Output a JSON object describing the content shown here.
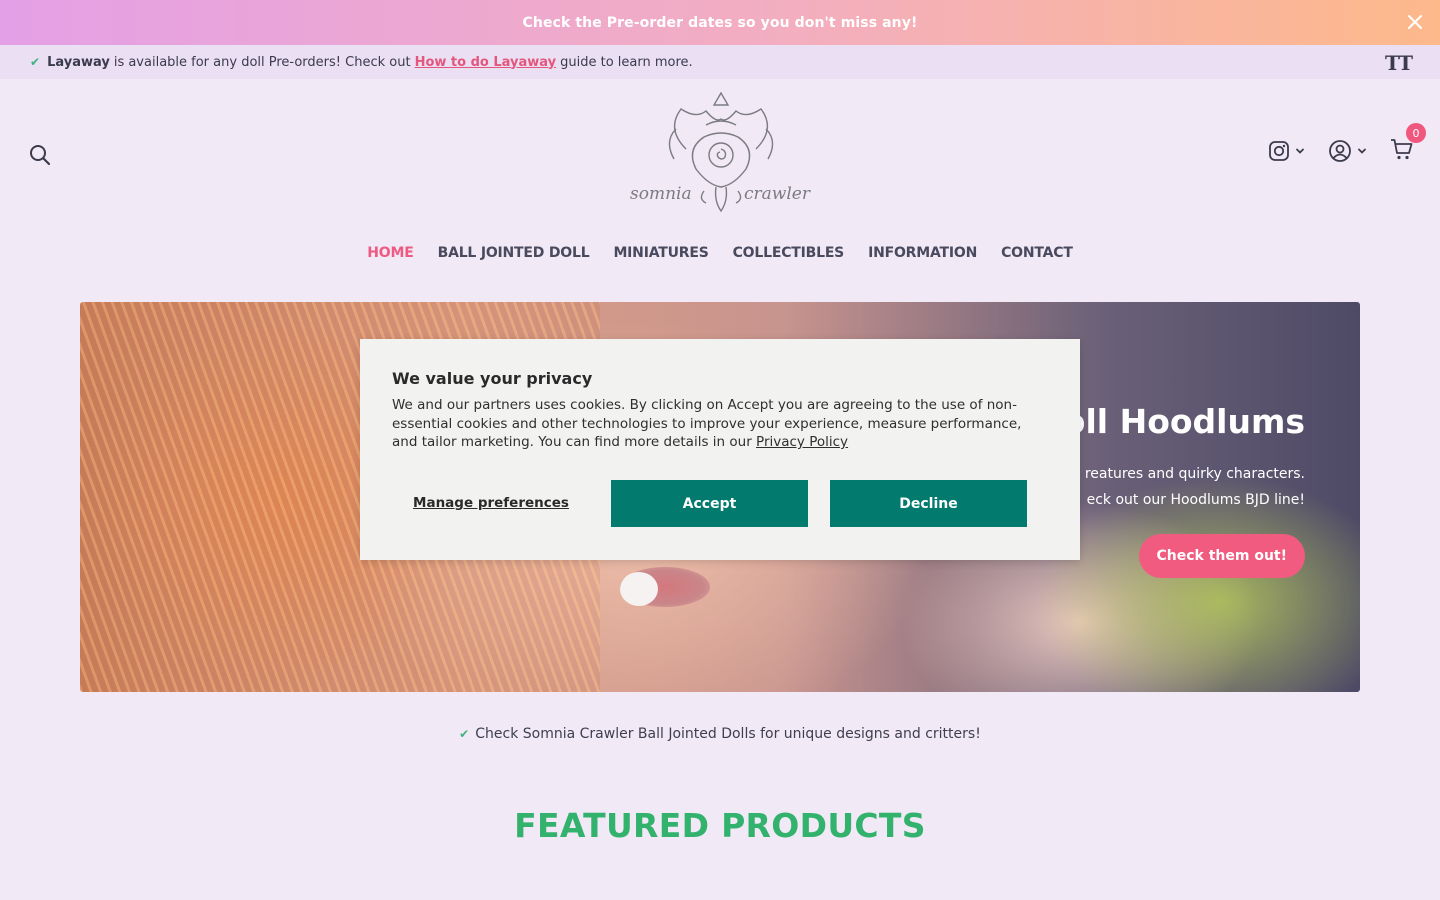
{
  "announcement": {
    "text": "Check the Pre-order dates so you don't miss any!"
  },
  "usp_bar": {
    "bold": "Layaway",
    "text_before": "is available for any doll Pre-orders! Check out",
    "link": "How to do Layaway",
    "text_after": "guide to learn more.",
    "font_toggle": "TT"
  },
  "brand": {
    "name_left": "somnia",
    "name_right": "crawler"
  },
  "cart": {
    "count": "0"
  },
  "nav": [
    {
      "label": "HOME"
    },
    {
      "label": "BALL JOINTED DOLL"
    },
    {
      "label": "MINIATURES"
    },
    {
      "label": "COLLECTIBLES"
    },
    {
      "label": "INFORMATION"
    },
    {
      "label": "CONTACT"
    }
  ],
  "hero": {
    "title": "oll Hoodlums",
    "line1": "reatures and quirky characters.",
    "line2": "eck out our Hoodlums BJD line!",
    "cta": "Check them out!"
  },
  "cookie": {
    "title": "We value your privacy",
    "body": "We and our partners uses cookies. By clicking on Accept you are agreeing to the use of non-essential cookies and other technologies to improve your experience, measure performance, and tailor marketing. You can find more details in our",
    "policy_link": "Privacy Policy",
    "manage": "Manage preferences",
    "accept": "Accept",
    "decline": "Decline"
  },
  "tagline": "Check Somnia Crawler Ball Jointed Dolls for unique designs and critters!",
  "featured_title": "FEATURED PRODUCTS",
  "colors": {
    "accent_pink": "#f05b7f",
    "nav_active": "#ee5a82",
    "cookie_button": "#027b6e",
    "featured_green": "#33b26e",
    "page_bg": "#f1e9f6"
  }
}
